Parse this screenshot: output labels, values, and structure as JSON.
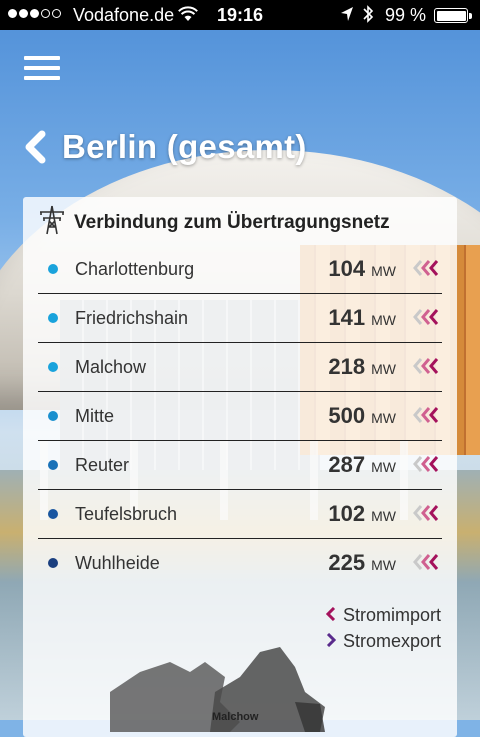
{
  "status": {
    "carrier": "Vodafone.de",
    "time": "19:16",
    "battery": "99 %",
    "signal_bars_filled": 3,
    "signal_bars_total": 5
  },
  "header": {
    "title": "Berlin (gesamt)"
  },
  "card": {
    "title": "Verbindung zum Übertragungsnetz",
    "unit": "MW",
    "rows": [
      {
        "name": "Charlottenburg",
        "value": "104",
        "color": "#1aa3dc",
        "flow": "import"
      },
      {
        "name": "Friedrichshain",
        "value": "141",
        "color": "#1aa3dc",
        "flow": "import"
      },
      {
        "name": "Malchow",
        "value": "218",
        "color": "#1aa3dc",
        "flow": "import"
      },
      {
        "name": "Mitte",
        "value": "500",
        "color": "#1a90cf",
        "flow": "import"
      },
      {
        "name": "Reuter",
        "value": "287",
        "color": "#1a72b8",
        "flow": "import"
      },
      {
        "name": "Teufelsbruch",
        "value": "102",
        "color": "#1a56a0",
        "flow": "import"
      },
      {
        "name": "Wuhlheide",
        "value": "225",
        "color": "#1a3f7f",
        "flow": "import"
      }
    ]
  },
  "legend": {
    "import_label": "Stromimport",
    "export_label": "Stromexport",
    "import_color": "#a4125c",
    "export_color": "#5a2b8c"
  },
  "map": {
    "label": "Malchow"
  }
}
